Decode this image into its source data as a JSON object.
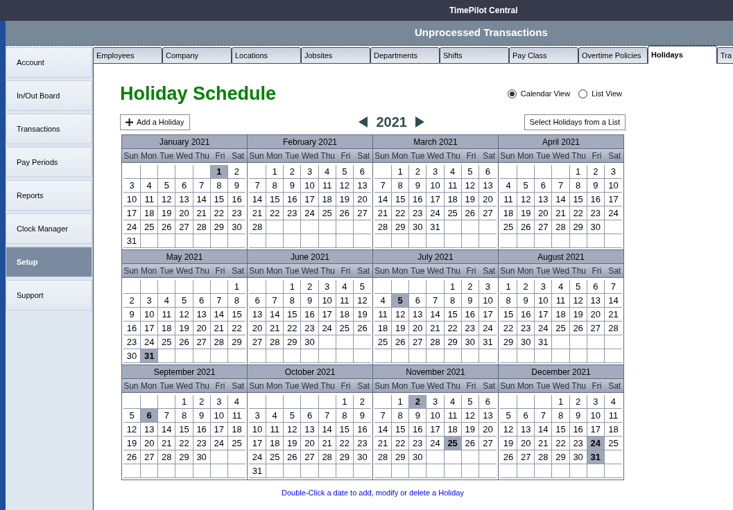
{
  "window": {
    "title": "TimePilot Central"
  },
  "header": {
    "title": "Unprocessed Transactions"
  },
  "sidebar": {
    "items": [
      {
        "label": "Account",
        "selected": false
      },
      {
        "label": "In/Out Board",
        "selected": false
      },
      {
        "label": "Transactions",
        "selected": false
      },
      {
        "label": "Pay Periods",
        "selected": false
      },
      {
        "label": "Reports",
        "selected": false
      },
      {
        "label": "Clock Manager",
        "selected": false
      },
      {
        "label": "Setup",
        "selected": true
      },
      {
        "label": "Support",
        "selected": false
      }
    ]
  },
  "tabs": [
    {
      "label": "Employees",
      "selected": false
    },
    {
      "label": "Company",
      "selected": false
    },
    {
      "label": "Locations",
      "selected": false
    },
    {
      "label": "Jobsites",
      "selected": false
    },
    {
      "label": "Departments",
      "selected": false
    },
    {
      "label": "Shifts",
      "selected": false
    },
    {
      "label": "Pay Class",
      "selected": false
    },
    {
      "label": "Overtime Policies",
      "selected": false
    },
    {
      "label": "Holidays",
      "selected": true
    },
    {
      "label": "Tra",
      "selected": false
    }
  ],
  "page": {
    "title": "Holiday Schedule",
    "views": [
      {
        "label": "Calendar View",
        "selected": true
      },
      {
        "label": "List View",
        "selected": false
      }
    ],
    "add_button": "Add a Holiday",
    "year": "2021",
    "select_button": "Select Holidays from a List",
    "months": [
      {
        "title": "January 2021",
        "weekdays": [
          "Sun",
          "Mon",
          "Tue",
          "Wed",
          "Thu",
          "Fri",
          "Sat"
        ],
        "weeks": [
          [
            {
              "day": "1",
              "holiday": true
            },
            {
              "day": "2",
              "holiday": false
            }
          ],
          [
            {
              "day": "3",
              "holiday": false
            },
            {
              "day": "4",
              "holiday": false
            },
            {
              "day": "5",
              "holiday": false
            },
            {
              "day": "6",
              "holiday": false
            },
            {
              "day": "7",
              "holiday": false
            },
            {
              "day": "8",
              "holiday": false
            },
            {
              "day": "9",
              "holiday": false
            }
          ],
          [
            {
              "day": "10",
              "holiday": false
            },
            {
              "day": "11",
              "holiday": false
            },
            {
              "day": "12",
              "holiday": false
            },
            {
              "day": "13",
              "holiday": false
            },
            {
              "day": "14",
              "holiday": false
            },
            {
              "day": "15",
              "holiday": false
            },
            {
              "day": "16",
              "holiday": false
            }
          ],
          [
            {
              "day": "17",
              "holiday": false
            },
            {
              "day": "18",
              "holiday": false
            },
            {
              "day": "19",
              "holiday": false
            },
            {
              "day": "20",
              "holiday": false
            },
            {
              "day": "21",
              "holiday": false
            },
            {
              "day": "22",
              "holiday": false
            },
            {
              "day": "23",
              "holiday": false
            }
          ],
          [
            {
              "day": "24",
              "holiday": false
            },
            {
              "day": "25",
              "holiday": false
            },
            {
              "day": "26",
              "holiday": false
            },
            {
              "day": "27",
              "holiday": false
            },
            {
              "day": "28",
              "holiday": false
            },
            {
              "day": "29",
              "holiday": false
            },
            {
              "day": "30",
              "holiday": false
            }
          ],
          [
            {
              "day": "31",
              "holiday": false
            }
          ]
        ]
      },
      {
        "title": "February 2021",
        "weekdays": [
          "Sun",
          "Mon",
          "Tue",
          "Wed",
          "Thu",
          "Fri",
          "Sat"
        ],
        "weeks": [
          [
            {
              "day": "1",
              "holiday": false
            },
            {
              "day": "2",
              "holiday": false
            },
            {
              "day": "3",
              "holiday": false
            },
            {
              "day": "4",
              "holiday": false
            },
            {
              "day": "5",
              "holiday": false
            },
            {
              "day": "6",
              "holiday": false
            }
          ],
          [
            {
              "day": "7",
              "holiday": false
            },
            {
              "day": "8",
              "holiday": false
            },
            {
              "day": "9",
              "holiday": false
            },
            {
              "day": "10",
              "holiday": false
            },
            {
              "day": "11",
              "holiday": false
            },
            {
              "day": "12",
              "holiday": false
            },
            {
              "day": "13",
              "holiday": false
            }
          ],
          [
            {
              "day": "14",
              "holiday": false
            },
            {
              "day": "15",
              "holiday": false
            },
            {
              "day": "16",
              "holiday": false
            },
            {
              "day": "17",
              "holiday": false
            },
            {
              "day": "18",
              "holiday": false
            },
            {
              "day": "19",
              "holiday": false
            },
            {
              "day": "20",
              "holiday": false
            }
          ],
          [
            {
              "day": "21",
              "holiday": false
            },
            {
              "day": "22",
              "holiday": false
            },
            {
              "day": "23",
              "holiday": false
            },
            {
              "day": "24",
              "holiday": false
            },
            {
              "day": "25",
              "holiday": false
            },
            {
              "day": "26",
              "holiday": false
            },
            {
              "day": "27",
              "holiday": false
            }
          ],
          [
            {
              "day": "28",
              "holiday": false
            }
          ]
        ]
      },
      {
        "title": "March 2021",
        "weekdays": [
          "Sun",
          "Mon",
          "Tue",
          "Wed",
          "Thu",
          "Fri",
          "Sat"
        ],
        "weeks": [
          [
            {
              "day": "1",
              "holiday": false
            },
            {
              "day": "2",
              "holiday": false
            },
            {
              "day": "3",
              "holiday": false
            },
            {
              "day": "4",
              "holiday": false
            },
            {
              "day": "5",
              "holiday": false
            },
            {
              "day": "6",
              "holiday": false
            }
          ],
          [
            {
              "day": "7",
              "holiday": false
            },
            {
              "day": "8",
              "holiday": false
            },
            {
              "day": "9",
              "holiday": false
            },
            {
              "day": "10",
              "holiday": false
            },
            {
              "day": "11",
              "holiday": false
            },
            {
              "day": "12",
              "holiday": false
            },
            {
              "day": "13",
              "holiday": false
            }
          ],
          [
            {
              "day": "14",
              "holiday": false
            },
            {
              "day": "15",
              "holiday": false
            },
            {
              "day": "16",
              "holiday": false
            },
            {
              "day": "17",
              "holiday": false
            },
            {
              "day": "18",
              "holiday": false
            },
            {
              "day": "19",
              "holiday": false
            },
            {
              "day": "20",
              "holiday": false
            }
          ],
          [
            {
              "day": "21",
              "holiday": false
            },
            {
              "day": "22",
              "holiday": false
            },
            {
              "day": "23",
              "holiday": false
            },
            {
              "day": "24",
              "holiday": false
            },
            {
              "day": "25",
              "holiday": false
            },
            {
              "day": "26",
              "holiday": false
            },
            {
              "day": "27",
              "holiday": false
            }
          ],
          [
            {
              "day": "28",
              "holiday": false
            },
            {
              "day": "29",
              "holiday": false
            },
            {
              "day": "30",
              "holiday": false
            },
            {
              "day": "31",
              "holiday": false
            }
          ]
        ]
      },
      {
        "title": "April 2021",
        "weekdays": [
          "Sun",
          "Mon",
          "Tue",
          "Wed",
          "Thu",
          "Fri",
          "Sat"
        ],
        "weeks": [
          [
            {
              "day": "1",
              "holiday": false
            },
            {
              "day": "2",
              "holiday": false
            },
            {
              "day": "3",
              "holiday": false
            }
          ],
          [
            {
              "day": "4",
              "holiday": false
            },
            {
              "day": "5",
              "holiday": false
            },
            {
              "day": "6",
              "holiday": false
            },
            {
              "day": "7",
              "holiday": false
            },
            {
              "day": "8",
              "holiday": false
            },
            {
              "day": "9",
              "holiday": false
            },
            {
              "day": "10",
              "holiday": false
            }
          ],
          [
            {
              "day": "11",
              "holiday": false
            },
            {
              "day": "12",
              "holiday": false
            },
            {
              "day": "13",
              "holiday": false
            },
            {
              "day": "14",
              "holiday": false
            },
            {
              "day": "15",
              "holiday": false
            },
            {
              "day": "16",
              "holiday": false
            },
            {
              "day": "17",
              "holiday": false
            }
          ],
          [
            {
              "day": "18",
              "holiday": false
            },
            {
              "day": "19",
              "holiday": false
            },
            {
              "day": "20",
              "holiday": false
            },
            {
              "day": "21",
              "holiday": false
            },
            {
              "day": "22",
              "holiday": false
            },
            {
              "day": "23",
              "holiday": false
            },
            {
              "day": "24",
              "holiday": false
            }
          ],
          [
            {
              "day": "25",
              "holiday": false
            },
            {
              "day": "26",
              "holiday": false
            },
            {
              "day": "27",
              "holiday": false
            },
            {
              "day": "28",
              "holiday": false
            },
            {
              "day": "29",
              "holiday": false
            },
            {
              "day": "30",
              "holiday": false
            }
          ]
        ]
      },
      {
        "title": "May 2021",
        "weekdays": [
          "Sun",
          "Mon",
          "Tue",
          "Wed",
          "Thu",
          "Fri",
          "Sat"
        ],
        "weeks": [
          [
            {
              "day": "1",
              "holiday": false
            }
          ],
          [
            {
              "day": "2",
              "holiday": false
            },
            {
              "day": "3",
              "holiday": false
            },
            {
              "day": "4",
              "holiday": false
            },
            {
              "day": "5",
              "holiday": false
            },
            {
              "day": "6",
              "holiday": false
            },
            {
              "day": "7",
              "holiday": false
            },
            {
              "day": "8",
              "holiday": false
            }
          ],
          [
            {
              "day": "9",
              "holiday": false
            },
            {
              "day": "10",
              "holiday": false
            },
            {
              "day": "11",
              "holiday": false
            },
            {
              "day": "12",
              "holiday": false
            },
            {
              "day": "13",
              "holiday": false
            },
            {
              "day": "14",
              "holiday": false
            },
            {
              "day": "15",
              "holiday": false
            }
          ],
          [
            {
              "day": "16",
              "holiday": false
            },
            {
              "day": "17",
              "holiday": false
            },
            {
              "day": "18",
              "holiday": false
            },
            {
              "day": "19",
              "holiday": false
            },
            {
              "day": "20",
              "holiday": false
            },
            {
              "day": "21",
              "holiday": false
            },
            {
              "day": "22",
              "holiday": false
            }
          ],
          [
            {
              "day": "23",
              "holiday": false
            },
            {
              "day": "24",
              "holiday": false
            },
            {
              "day": "25",
              "holiday": false
            },
            {
              "day": "26",
              "holiday": false
            },
            {
              "day": "27",
              "holiday": false
            },
            {
              "day": "28",
              "holiday": false
            },
            {
              "day": "29",
              "holiday": false
            }
          ],
          [
            {
              "day": "30",
              "holiday": false
            },
            {
              "day": "31",
              "holiday": true
            }
          ]
        ]
      },
      {
        "title": "June 2021",
        "weekdays": [
          "Sun",
          "Mon",
          "Tue",
          "Wed",
          "Thu",
          "Fri",
          "Sat"
        ],
        "weeks": [
          [
            {
              "day": "1",
              "holiday": false
            },
            {
              "day": "2",
              "holiday": false
            },
            {
              "day": "3",
              "holiday": false
            },
            {
              "day": "4",
              "holiday": false
            },
            {
              "day": "5",
              "holiday": false
            }
          ],
          [
            {
              "day": "6",
              "holiday": false
            },
            {
              "day": "7",
              "holiday": false
            },
            {
              "day": "8",
              "holiday": false
            },
            {
              "day": "9",
              "holiday": false
            },
            {
              "day": "10",
              "holiday": false
            },
            {
              "day": "11",
              "holiday": false
            },
            {
              "day": "12",
              "holiday": false
            }
          ],
          [
            {
              "day": "13",
              "holiday": false
            },
            {
              "day": "14",
              "holiday": false
            },
            {
              "day": "15",
              "holiday": false
            },
            {
              "day": "16",
              "holiday": false
            },
            {
              "day": "17",
              "holiday": false
            },
            {
              "day": "18",
              "holiday": false
            },
            {
              "day": "19",
              "holiday": false
            }
          ],
          [
            {
              "day": "20",
              "holiday": false
            },
            {
              "day": "21",
              "holiday": false
            },
            {
              "day": "22",
              "holiday": false
            },
            {
              "day": "23",
              "holiday": false
            },
            {
              "day": "24",
              "holiday": false
            },
            {
              "day": "25",
              "holiday": false
            },
            {
              "day": "26",
              "holiday": false
            }
          ],
          [
            {
              "day": "27",
              "holiday": false
            },
            {
              "day": "28",
              "holiday": false
            },
            {
              "day": "29",
              "holiday": false
            },
            {
              "day": "30",
              "holiday": false
            }
          ]
        ]
      },
      {
        "title": "July 2021",
        "weekdays": [
          "Sun",
          "Mon",
          "Tue",
          "Wed",
          "Thu",
          "Fri",
          "Sat"
        ],
        "weeks": [
          [
            {
              "day": "1",
              "holiday": false
            },
            {
              "day": "2",
              "holiday": false
            },
            {
              "day": "3",
              "holiday": false
            }
          ],
          [
            {
              "day": "4",
              "holiday": false
            },
            {
              "day": "5",
              "holiday": true
            },
            {
              "day": "6",
              "holiday": false
            },
            {
              "day": "7",
              "holiday": false
            },
            {
              "day": "8",
              "holiday": false
            },
            {
              "day": "9",
              "holiday": false
            },
            {
              "day": "10",
              "holiday": false
            }
          ],
          [
            {
              "day": "11",
              "holiday": false
            },
            {
              "day": "12",
              "holiday": false
            },
            {
              "day": "13",
              "holiday": false
            },
            {
              "day": "14",
              "holiday": false
            },
            {
              "day": "15",
              "holiday": false
            },
            {
              "day": "16",
              "holiday": false
            },
            {
              "day": "17",
              "holiday": false
            }
          ],
          [
            {
              "day": "18",
              "holiday": false
            },
            {
              "day": "19",
              "holiday": false
            },
            {
              "day": "20",
              "holiday": false
            },
            {
              "day": "21",
              "holiday": false
            },
            {
              "day": "22",
              "holiday": false
            },
            {
              "day": "23",
              "holiday": false
            },
            {
              "day": "24",
              "holiday": false
            }
          ],
          [
            {
              "day": "25",
              "holiday": false
            },
            {
              "day": "26",
              "holiday": false
            },
            {
              "day": "27",
              "holiday": false
            },
            {
              "day": "28",
              "holiday": false
            },
            {
              "day": "29",
              "holiday": false
            },
            {
              "day": "30",
              "holiday": false
            },
            {
              "day": "31",
              "holiday": false
            }
          ]
        ]
      },
      {
        "title": "August 2021",
        "weekdays": [
          "Sun",
          "Mon",
          "Tue",
          "Wed",
          "Thu",
          "Fri",
          "Sat"
        ],
        "weeks": [
          [
            {
              "day": "1",
              "holiday": false
            },
            {
              "day": "2",
              "holiday": false
            },
            {
              "day": "3",
              "holiday": false
            },
            {
              "day": "4",
              "holiday": false
            },
            {
              "day": "5",
              "holiday": false
            },
            {
              "day": "6",
              "holiday": false
            },
            {
              "day": "7",
              "holiday": false
            }
          ],
          [
            {
              "day": "8",
              "holiday": false
            },
            {
              "day": "9",
              "holiday": false
            },
            {
              "day": "10",
              "holiday": false
            },
            {
              "day": "11",
              "holiday": false
            },
            {
              "day": "12",
              "holiday": false
            },
            {
              "day": "13",
              "holiday": false
            },
            {
              "day": "14",
              "holiday": false
            }
          ],
          [
            {
              "day": "15",
              "holiday": false
            },
            {
              "day": "16",
              "holiday": false
            },
            {
              "day": "17",
              "holiday": false
            },
            {
              "day": "18",
              "holiday": false
            },
            {
              "day": "19",
              "holiday": false
            },
            {
              "day": "20",
              "holiday": false
            },
            {
              "day": "21",
              "holiday": false
            }
          ],
          [
            {
              "day": "22",
              "holiday": false
            },
            {
              "day": "23",
              "holiday": false
            },
            {
              "day": "24",
              "holiday": false
            },
            {
              "day": "25",
              "holiday": false
            },
            {
              "day": "26",
              "holiday": false
            },
            {
              "day": "27",
              "holiday": false
            },
            {
              "day": "28",
              "holiday": false
            }
          ],
          [
            {
              "day": "29",
              "holiday": false
            },
            {
              "day": "30",
              "holiday": false
            },
            {
              "day": "31",
              "holiday": false
            }
          ]
        ]
      },
      {
        "title": "September 2021",
        "weekdays": [
          "Sun",
          "Mon",
          "Tue",
          "Wed",
          "Thu",
          "Fri",
          "Sat"
        ],
        "weeks": [
          [
            {
              "day": "1",
              "holiday": false
            },
            {
              "day": "2",
              "holiday": false
            },
            {
              "day": "3",
              "holiday": false
            },
            {
              "day": "4",
              "holiday": false
            }
          ],
          [
            {
              "day": "5",
              "holiday": false
            },
            {
              "day": "6",
              "holiday": true
            },
            {
              "day": "7",
              "holiday": false
            },
            {
              "day": "8",
              "holiday": false
            },
            {
              "day": "9",
              "holiday": false
            },
            {
              "day": "10",
              "holiday": false
            },
            {
              "day": "11",
              "holiday": false
            }
          ],
          [
            {
              "day": "12",
              "holiday": false
            },
            {
              "day": "13",
              "holiday": false
            },
            {
              "day": "14",
              "holiday": false
            },
            {
              "day": "15",
              "holiday": false
            },
            {
              "day": "16",
              "holiday": false
            },
            {
              "day": "17",
              "holiday": false
            },
            {
              "day": "18",
              "holiday": false
            }
          ],
          [
            {
              "day": "19",
              "holiday": false
            },
            {
              "day": "20",
              "holiday": false
            },
            {
              "day": "21",
              "holiday": false
            },
            {
              "day": "22",
              "holiday": false
            },
            {
              "day": "23",
              "holiday": false
            },
            {
              "day": "24",
              "holiday": false
            },
            {
              "day": "25",
              "holiday": false
            }
          ],
          [
            {
              "day": "26",
              "holiday": false
            },
            {
              "day": "27",
              "holiday": false
            },
            {
              "day": "28",
              "holiday": false
            },
            {
              "day": "29",
              "holiday": false
            },
            {
              "day": "30",
              "holiday": false
            }
          ]
        ]
      },
      {
        "title": "October 2021",
        "weekdays": [
          "Sun",
          "Mon",
          "Tue",
          "Wed",
          "Thu",
          "Fri",
          "Sat"
        ],
        "weeks": [
          [
            {
              "day": "1",
              "holiday": false
            },
            {
              "day": "2",
              "holiday": false
            }
          ],
          [
            {
              "day": "3",
              "holiday": false
            },
            {
              "day": "4",
              "holiday": false
            },
            {
              "day": "5",
              "holiday": false
            },
            {
              "day": "6",
              "holiday": false
            },
            {
              "day": "7",
              "holiday": false
            },
            {
              "day": "8",
              "holiday": false
            },
            {
              "day": "9",
              "holiday": false
            }
          ],
          [
            {
              "day": "10",
              "holiday": false
            },
            {
              "day": "11",
              "holiday": false
            },
            {
              "day": "12",
              "holiday": false
            },
            {
              "day": "13",
              "holiday": false
            },
            {
              "day": "14",
              "holiday": false
            },
            {
              "day": "15",
              "holiday": false
            },
            {
              "day": "16",
              "holiday": false
            }
          ],
          [
            {
              "day": "17",
              "holiday": false
            },
            {
              "day": "18",
              "holiday": false
            },
            {
              "day": "19",
              "holiday": false
            },
            {
              "day": "20",
              "holiday": false
            },
            {
              "day": "21",
              "holiday": false
            },
            {
              "day": "22",
              "holiday": false
            },
            {
              "day": "23",
              "holiday": false
            }
          ],
          [
            {
              "day": "24",
              "holiday": false
            },
            {
              "day": "25",
              "holiday": false
            },
            {
              "day": "26",
              "holiday": false
            },
            {
              "day": "27",
              "holiday": false
            },
            {
              "day": "28",
              "holiday": false
            },
            {
              "day": "29",
              "holiday": false
            },
            {
              "day": "30",
              "holiday": false
            }
          ],
          [
            {
              "day": "31",
              "holiday": false
            }
          ]
        ]
      },
      {
        "title": "November 2021",
        "weekdays": [
          "Sun",
          "Mon",
          "Tue",
          "Wed",
          "Thu",
          "Fri",
          "Sat"
        ],
        "weeks": [
          [
            {
              "day": "1",
              "holiday": false
            },
            {
              "day": "2",
              "holiday": true
            },
            {
              "day": "3",
              "holiday": false
            },
            {
              "day": "4",
              "holiday": false
            },
            {
              "day": "5",
              "holiday": false
            },
            {
              "day": "6",
              "holiday": false
            }
          ],
          [
            {
              "day": "7",
              "holiday": false
            },
            {
              "day": "8",
              "holiday": false
            },
            {
              "day": "9",
              "holiday": false
            },
            {
              "day": "10",
              "holiday": false
            },
            {
              "day": "11",
              "holiday": false
            },
            {
              "day": "12",
              "holiday": false
            },
            {
              "day": "13",
              "holiday": false
            }
          ],
          [
            {
              "day": "14",
              "holiday": false
            },
            {
              "day": "15",
              "holiday": false
            },
            {
              "day": "16",
              "holiday": false
            },
            {
              "day": "17",
              "holiday": false
            },
            {
              "day": "18",
              "holiday": false
            },
            {
              "day": "19",
              "holiday": false
            },
            {
              "day": "20",
              "holiday": false
            }
          ],
          [
            {
              "day": "21",
              "holiday": false
            },
            {
              "day": "22",
              "holiday": false
            },
            {
              "day": "23",
              "holiday": false
            },
            {
              "day": "24",
              "holiday": false
            },
            {
              "day": "25",
              "holiday": true
            },
            {
              "day": "26",
              "holiday": false
            },
            {
              "day": "27",
              "holiday": false
            }
          ],
          [
            {
              "day": "28",
              "holiday": false
            },
            {
              "day": "29",
              "holiday": false
            },
            {
              "day": "30",
              "holiday": false
            }
          ]
        ]
      },
      {
        "title": "December 2021",
        "weekdays": [
          "Sun",
          "Mon",
          "Tue",
          "Wed",
          "Thu",
          "Fri",
          "Sat"
        ],
        "weeks": [
          [
            {
              "day": "1",
              "holiday": false
            },
            {
              "day": "2",
              "holiday": false
            },
            {
              "day": "3",
              "holiday": false
            },
            {
              "day": "4",
              "holiday": false
            }
          ],
          [
            {
              "day": "5",
              "holiday": false
            },
            {
              "day": "6",
              "holiday": false
            },
            {
              "day": "7",
              "holiday": false
            },
            {
              "day": "8",
              "holiday": false
            },
            {
              "day": "9",
              "holiday": false
            },
            {
              "day": "10",
              "holiday": false
            },
            {
              "day": "11",
              "holiday": false
            }
          ],
          [
            {
              "day": "12",
              "holiday": false
            },
            {
              "day": "13",
              "holiday": false
            },
            {
              "day": "14",
              "holiday": false
            },
            {
              "day": "15",
              "holiday": false
            },
            {
              "day": "16",
              "holiday": false
            },
            {
              "day": "17",
              "holiday": false
            },
            {
              "day": "18",
              "holiday": false
            }
          ],
          [
            {
              "day": "19",
              "holiday": false
            },
            {
              "day": "20",
              "holiday": false
            },
            {
              "day": "21",
              "holiday": false
            },
            {
              "day": "22",
              "holiday": false
            },
            {
              "day": "23",
              "holiday": false
            },
            {
              "day": "24",
              "holiday": true
            },
            {
              "day": "25",
              "holiday": false
            }
          ],
          [
            {
              "day": "26",
              "holiday": false
            },
            {
              "day": "27",
              "holiday": false
            },
            {
              "day": "28",
              "holiday": false
            },
            {
              "day": "29",
              "holiday": false
            },
            {
              "day": "30",
              "holiday": false
            },
            {
              "day": "31",
              "holiday": true
            }
          ]
        ]
      }
    ],
    "hint": "Double-Click a date to add, modify or delete a Holiday"
  }
}
